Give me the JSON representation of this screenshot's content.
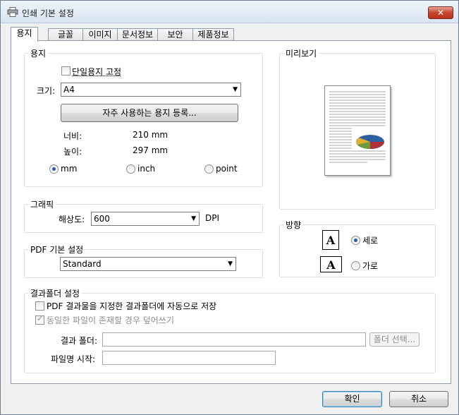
{
  "window": {
    "title": "인쇄 기본 설정",
    "close_label": "✕"
  },
  "tabs": [
    {
      "label": "용지",
      "active": true
    },
    {
      "label": "글꼴",
      "active": false
    },
    {
      "label": "이미지",
      "active": false
    },
    {
      "label": "문서정보",
      "active": false
    },
    {
      "label": "보안",
      "active": false
    },
    {
      "label": "제품정보",
      "active": false
    }
  ],
  "paper": {
    "group_title": "용지",
    "fixed_single_label": "단일용지 고정",
    "size_label": "크기:",
    "size_value": "A4",
    "register_button": "자주 사용하는 용지 등록...",
    "width_label": "너비:",
    "width_value": "210 mm",
    "height_label": "높이:",
    "height_value": "297 mm",
    "units": [
      {
        "label": "mm",
        "selected": true
      },
      {
        "label": "inch",
        "selected": false
      },
      {
        "label": "point",
        "selected": false
      }
    ]
  },
  "graphics": {
    "group_title": "그래픽",
    "resolution_label": "해상도:",
    "resolution_value": "600",
    "dpi_label": "DPI"
  },
  "pdf": {
    "group_title": "PDF 기본 설정",
    "preset_value": "Standard"
  },
  "preview": {
    "group_title": "미리보기"
  },
  "orientation": {
    "group_title": "방향",
    "portrait_label": "세로",
    "landscape_label": "가로",
    "icon_letter": "A",
    "selected": "세로"
  },
  "result_folder": {
    "group_title": "결과폴더 설정",
    "auto_save_label": "PDF 결과물을 지정한 결과폴더에 자동으로 저장",
    "overwrite_label": "동일한 파일이 존재할 경우 덮어쓰기",
    "folder_label": "결과 폴더:",
    "folder_value": "",
    "select_folder_button": "폴더 선택...",
    "filename_label": "파일명 시작:",
    "filename_value": ""
  },
  "footer": {
    "ok_label": "확인",
    "cancel_label": "취소"
  }
}
